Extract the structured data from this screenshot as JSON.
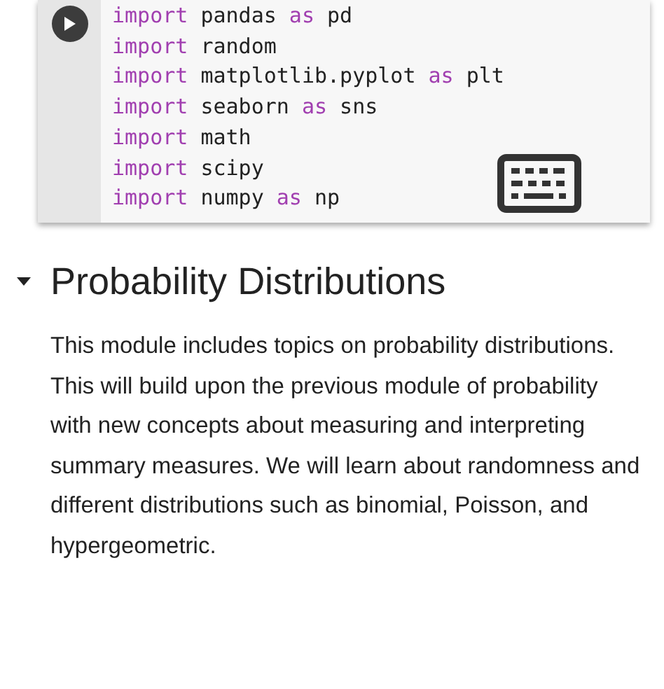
{
  "code_cell": {
    "lines": [
      [
        {
          "kind": "keyword",
          "text": "import"
        },
        {
          "kind": "plain",
          "text": "pandas"
        },
        {
          "kind": "keyword",
          "text": "as"
        },
        {
          "kind": "plain",
          "text": "pd"
        }
      ],
      [
        {
          "kind": "keyword",
          "text": "import"
        },
        {
          "kind": "plain",
          "text": "random"
        }
      ],
      [
        {
          "kind": "keyword",
          "text": "import"
        },
        {
          "kind": "plain",
          "text": "matplotlib.pyplot"
        },
        {
          "kind": "keyword",
          "text": "as"
        },
        {
          "kind": "plain",
          "text": "plt"
        }
      ],
      [
        {
          "kind": "keyword",
          "text": "import"
        },
        {
          "kind": "plain",
          "text": "seaborn"
        },
        {
          "kind": "keyword",
          "text": "as"
        },
        {
          "kind": "plain",
          "text": "sns"
        }
      ],
      [
        {
          "kind": "keyword",
          "text": "import"
        },
        {
          "kind": "plain",
          "text": "math"
        }
      ],
      [
        {
          "kind": "keyword",
          "text": "import"
        },
        {
          "kind": "plain",
          "text": "scipy"
        }
      ],
      [
        {
          "kind": "keyword",
          "text": "import"
        },
        {
          "kind": "plain",
          "text": "numpy"
        },
        {
          "kind": "keyword",
          "text": "as"
        },
        {
          "kind": "plain",
          "text": "np"
        }
      ]
    ]
  },
  "section": {
    "title": "Probability Distributions",
    "expanded": true,
    "text": "This module includes topics on probability distributions. This will build upon the previous module of probability with new concepts about measuring and interpreting summary measures. We will learn about randomness and different distributions such as binomial, Poisson, and hypergeometric."
  }
}
